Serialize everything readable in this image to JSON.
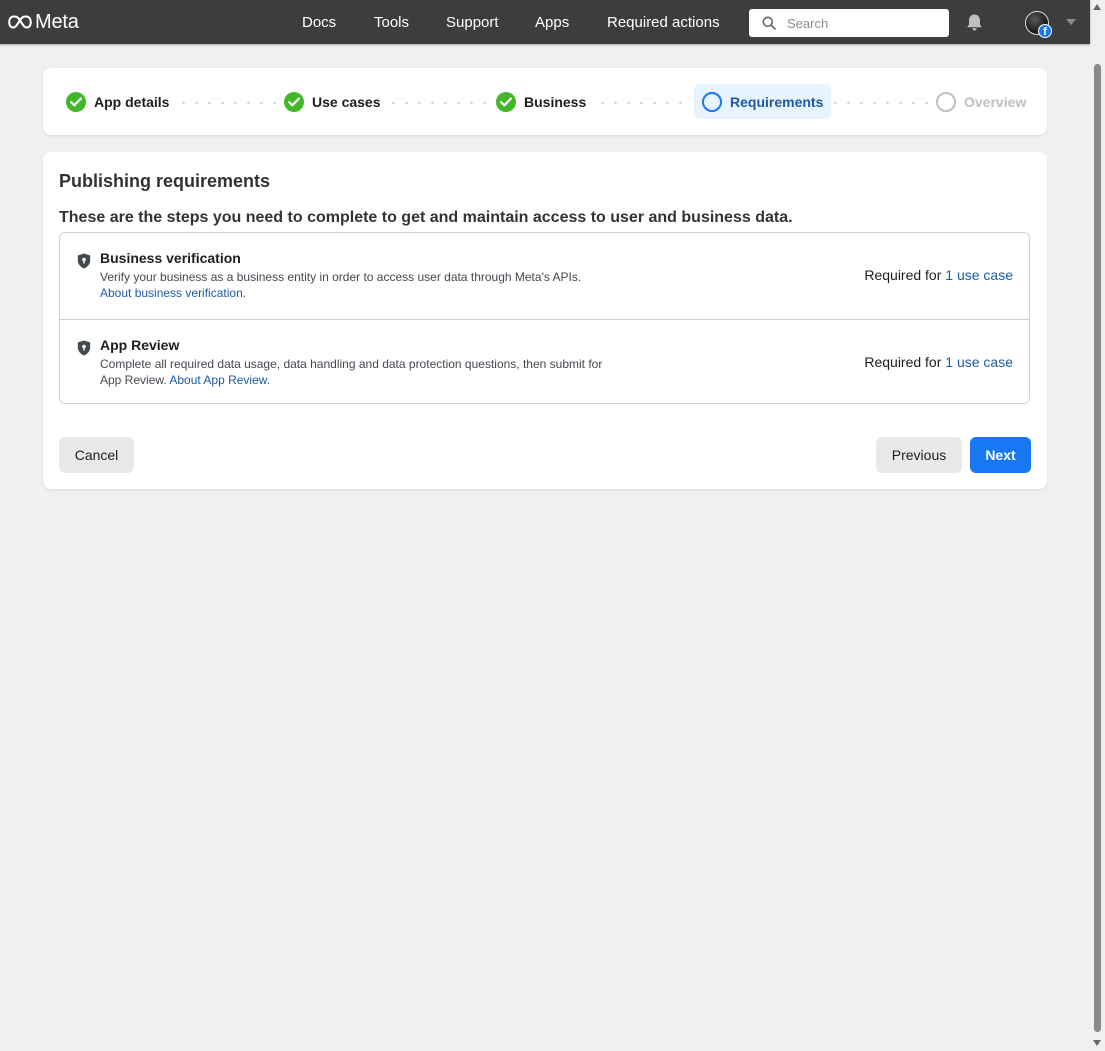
{
  "topbar": {
    "brand": "Meta",
    "nav": [
      "Docs",
      "Tools",
      "Support",
      "Apps",
      "Required actions"
    ],
    "search_placeholder": "Search",
    "badge": "f"
  },
  "stepper": {
    "steps": [
      {
        "label": "App details",
        "state": "complete"
      },
      {
        "label": "Use cases",
        "state": "complete"
      },
      {
        "label": "Business",
        "state": "complete"
      },
      {
        "label": "Requirements",
        "state": "active"
      },
      {
        "label": "Overview",
        "state": "pending"
      }
    ]
  },
  "requirements": {
    "title": "Publishing requirements",
    "subtitle": "These are the steps you need to complete to get and maintain access to user and business data.",
    "items": [
      {
        "title": "Business verification",
        "description": "Verify your business as a business entity in order to access user data through Meta's APIs.",
        "link": "About business verification.",
        "required_prefix": "Required for ",
        "required_link": "1 use case"
      },
      {
        "title": "App Review",
        "description": "Complete all required data usage, data handling and data protection questions, then submit for App Review.",
        "link": "About App Review.",
        "required_prefix": "Required for ",
        "required_link": "1 use case"
      }
    ]
  },
  "buttons": {
    "cancel": "Cancel",
    "previous": "Previous",
    "next": "Next"
  },
  "colors": {
    "accent": "#1877f2",
    "success": "#42b72a",
    "topbar": "#3d3d3d",
    "link": "#1d5aa8"
  }
}
